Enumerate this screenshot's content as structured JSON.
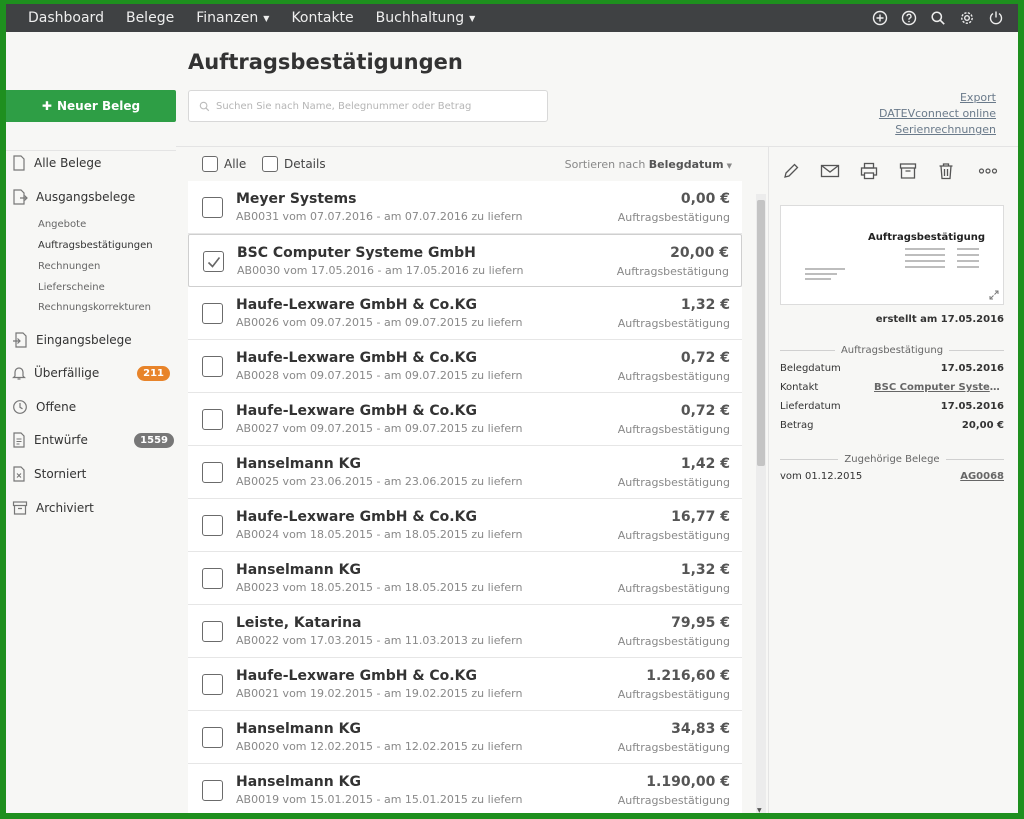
{
  "topbar": {
    "nav": [
      {
        "label": "Dashboard",
        "dropdown": false
      },
      {
        "label": "Belege",
        "dropdown": false
      },
      {
        "label": "Finanzen",
        "dropdown": true
      },
      {
        "label": "Kontakte",
        "dropdown": false
      },
      {
        "label": "Buchhaltung",
        "dropdown": true
      }
    ],
    "icons": [
      "plus-circle-icon",
      "help-icon",
      "search-icon",
      "gear-icon",
      "power-icon"
    ]
  },
  "sidebar": {
    "new_button": "Neuer Beleg",
    "items": [
      {
        "label": "Alle Belege",
        "icon": "document-icon"
      },
      {
        "label": "Ausgangsbelege",
        "icon": "document-out-icon"
      },
      {
        "label": "Eingangsbelege",
        "icon": "document-in-icon"
      },
      {
        "label": "Überfällige",
        "icon": "bell-icon",
        "badge": "211"
      },
      {
        "label": "Offene",
        "icon": "clock-icon"
      },
      {
        "label": "Entwürfe",
        "icon": "draft-icon",
        "badge": "1559"
      },
      {
        "label": "Storniert",
        "icon": "cancelled-icon"
      },
      {
        "label": "Archiviert",
        "icon": "archive-icon"
      }
    ],
    "subitems": [
      "Angebote",
      "Auftragsbestätigungen",
      "Rechnungen",
      "Lieferscheine",
      "Rechnungskorrekturen"
    ]
  },
  "main": {
    "title": "Auftragsbestätigungen",
    "search_placeholder": "Suchen Sie nach Name, Belegnummer oder Betrag",
    "links": [
      "Export",
      "DATEVconnect online",
      "Serienrechnungen"
    ],
    "select_all": "Alle",
    "details": "Details",
    "sort_prefix": "Sortieren nach",
    "sort_field": "Belegdatum"
  },
  "rows": [
    {
      "name": "Meyer Systems",
      "sub": "AB0031 vom 07.07.2016 - am 07.07.2016 zu liefern",
      "amount": "0,00 €",
      "type": "Auftragsbestätigung",
      "checked": false
    },
    {
      "name": "BSC Computer Systeme GmbH",
      "sub": "AB0030 vom 17.05.2016 - am 17.05.2016 zu liefern",
      "amount": "20,00 €",
      "type": "Auftragsbestätigung",
      "checked": true
    },
    {
      "name": "Haufe-Lexware GmbH & Co.KG",
      "sub": "AB0026 vom 09.07.2015 - am 09.07.2015 zu liefern",
      "amount": "1,32 €",
      "type": "Auftragsbestätigung",
      "checked": false
    },
    {
      "name": "Haufe-Lexware GmbH & Co.KG",
      "sub": "AB0028 vom 09.07.2015 - am 09.07.2015 zu liefern",
      "amount": "0,72 €",
      "type": "Auftragsbestätigung",
      "checked": false
    },
    {
      "name": "Haufe-Lexware GmbH & Co.KG",
      "sub": "AB0027 vom 09.07.2015 - am 09.07.2015 zu liefern",
      "amount": "0,72 €",
      "type": "Auftragsbestätigung",
      "checked": false
    },
    {
      "name": "Hanselmann KG",
      "sub": "AB0025 vom 23.06.2015 - am 23.06.2015 zu liefern",
      "amount": "1,42 €",
      "type": "Auftragsbestätigung",
      "checked": false
    },
    {
      "name": "Haufe-Lexware GmbH & Co.KG",
      "sub": "AB0024 vom 18.05.2015 - am 18.05.2015 zu liefern",
      "amount": "16,77 €",
      "type": "Auftragsbestätigung",
      "checked": false
    },
    {
      "name": "Hanselmann KG",
      "sub": "AB0023 vom 18.05.2015 - am 18.05.2015 zu liefern",
      "amount": "1,32 €",
      "type": "Auftragsbestätigung",
      "checked": false
    },
    {
      "name": "Leiste, Katarina",
      "sub": "AB0022 vom 17.03.2015 - am 11.03.2013 zu liefern",
      "amount": "79,95 €",
      "type": "Auftragsbestätigung",
      "checked": false
    },
    {
      "name": "Haufe-Lexware GmbH & Co.KG",
      "sub": "AB0021 vom 19.02.2015 - am 19.02.2015 zu liefern",
      "amount": "1.216,60 €",
      "type": "Auftragsbestätigung",
      "checked": false
    },
    {
      "name": "Hanselmann KG",
      "sub": "AB0020 vom 12.02.2015 - am 12.02.2015 zu liefern",
      "amount": "34,83 €",
      "type": "Auftragsbestätigung",
      "checked": false
    },
    {
      "name": "Hanselmann KG",
      "sub": "AB0019 vom 15.01.2015 - am 15.01.2015 zu liefern",
      "amount": "1.190,00 €",
      "type": "Auftragsbestätigung",
      "checked": false
    }
  ],
  "detail": {
    "toolbar_icons": [
      "edit-icon",
      "mail-icon",
      "print-icon",
      "archive-icon",
      "trash-icon",
      "more-icon"
    ],
    "preview_title": "Auftragsbestätigung",
    "created": "erstellt am 17.05.2016",
    "section1": "Auftragsbestätigung",
    "fields": [
      {
        "key": "Belegdatum",
        "value": "17.05.2016"
      },
      {
        "key": "Kontakt",
        "value": "BSC Computer Systeme GmbH"
      },
      {
        "key": "Lieferdatum",
        "value": "17.05.2016"
      },
      {
        "key": "Betrag",
        "value": "20,00 €"
      }
    ],
    "section2": "Zugehörige Belege",
    "related": {
      "key": "vom 01.12.2015",
      "value": "AG0068"
    }
  },
  "colors": {
    "accent": "#2e9e45",
    "topbar": "#3f4143",
    "badge_orange": "#e8842a",
    "badge_gray": "#777777"
  }
}
